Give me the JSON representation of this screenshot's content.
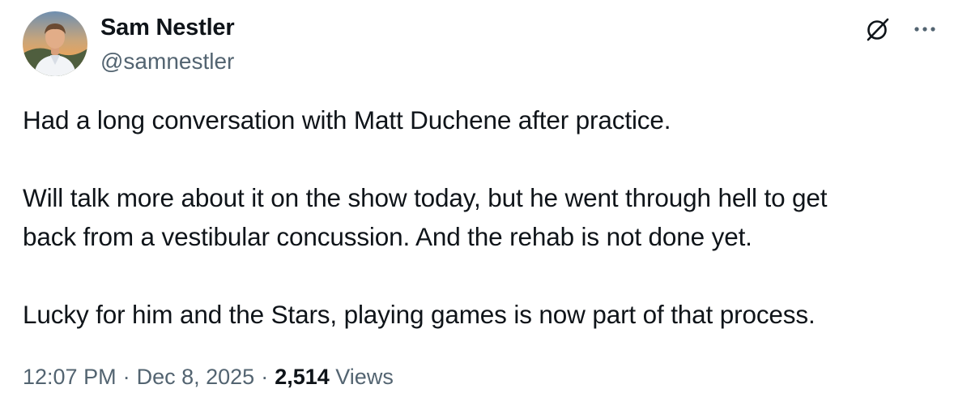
{
  "author": {
    "display_name": "Sam Nestler",
    "handle": "@samnestler",
    "avatar_icon": "profile-photo"
  },
  "actions": {
    "grok_icon": "grok-icon",
    "more_icon": "more-horizontal-icon"
  },
  "tweet": {
    "paragraphs": [
      [
        "Had a long conversation with Matt Duchene after practice."
      ],
      [
        "Will talk more about it on the show today, but he went through hell to get",
        "back from a vestibular concussion. And the rehab is not done yet."
      ],
      [
        "Lucky for him and the Stars, playing games is now part of that process."
      ]
    ]
  },
  "meta": {
    "time": "12:07 PM",
    "separator": "·",
    "date": "Dec 8, 2025",
    "views_count": "2,514",
    "views_label": "Views"
  },
  "colors": {
    "text_primary": "#0f1419",
    "text_secondary": "#536471",
    "background": "#ffffff"
  }
}
